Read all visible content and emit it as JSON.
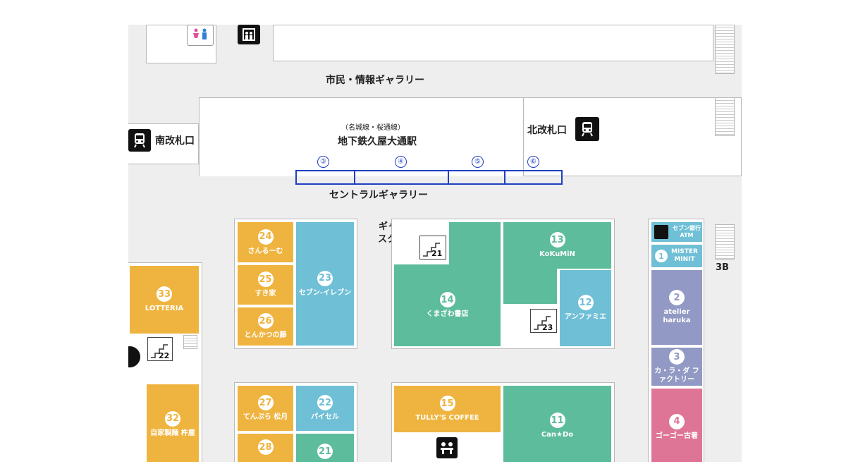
{
  "labels": {
    "gallery_top": "市民・情報ギャラリー",
    "line_note": "（名城線・桜通線）",
    "station": "地下鉄久屋大通駅",
    "south_gate": "南改札口",
    "north_gate": "北改札口",
    "central_gallery": "セントラルギャラリー",
    "gallery_square_1": "ギャラリー",
    "gallery_square_2": "スクエア",
    "floor_3b": "3B"
  },
  "spots": [
    "③",
    "④",
    "⑤",
    "⑥"
  ],
  "stairs": [
    "21",
    "23",
    "22"
  ],
  "shops": [
    {
      "num": "24",
      "name": "さんるーむ",
      "color": "yellow"
    },
    {
      "num": "25",
      "name": "すき家",
      "color": "yellow"
    },
    {
      "num": "26",
      "name": "とんかつの藤",
      "color": "yellow"
    },
    {
      "num": "23",
      "name": "セブン-イレブン",
      "color": "blue"
    },
    {
      "num": "33",
      "name": "LOTTERIA",
      "color": "yellow"
    },
    {
      "num": "32",
      "name": "自家製麺 杵屋",
      "color": "yellow"
    },
    {
      "num": "27",
      "name": "てんぷら 松月",
      "color": "yellow"
    },
    {
      "num": "22",
      "name": "パイセル",
      "color": "blue"
    },
    {
      "num": "28",
      "name": "",
      "color": "yellow"
    },
    {
      "num": "21",
      "name": "",
      "color": "green"
    },
    {
      "num": "14",
      "name": "くまざわ書店",
      "color": "green"
    },
    {
      "num": "13",
      "name": "KoKuMiN",
      "color": "green"
    },
    {
      "num": "12",
      "name": "アンファミエ",
      "color": "blue"
    },
    {
      "num": "15",
      "name": "TULLY'S COFFEE",
      "color": "yellow"
    },
    {
      "num": "11",
      "name": "Can★Do",
      "color": "green"
    },
    {
      "num": "1",
      "name": "MISTER MINIT",
      "color": "blue"
    },
    {
      "num": "2",
      "name": "atelier haruka",
      "color": "purple"
    },
    {
      "num": "3",
      "name": "カ・ラ・ダ ファクトリー",
      "color": "purple"
    },
    {
      "num": "4",
      "name": "ゴーゴー古着",
      "color": "pink"
    }
  ],
  "atm": {
    "label": "セブン銀行ATM",
    "icon": "atm-icon"
  },
  "icons": [
    "restroom-icon",
    "elevator-icon",
    "train-icon",
    "dining-icon"
  ]
}
